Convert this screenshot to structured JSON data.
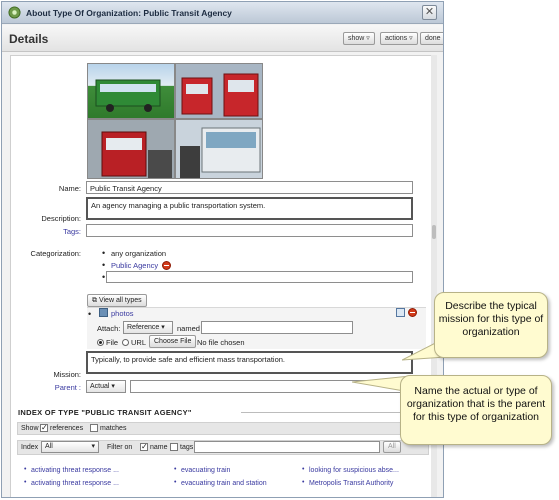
{
  "window": {
    "title": "About Type Of Organization: Public Transit Agency"
  },
  "header": {
    "title": "Details",
    "show_label": "show",
    "actions_label": "actions",
    "done_label": "done"
  },
  "form": {
    "name_label": "Name:",
    "name_value": "Public Transit Agency",
    "description_label": "Description:",
    "description_value": "An agency managing a public transportation system.",
    "tags_label": "Tags:",
    "categorization_label": "Categorization:",
    "categories": [
      "any organization",
      "Public Agency"
    ],
    "view_all_types_label": "View all types",
    "attachment_name": "photos",
    "attach_label": "Attach:",
    "attach_type": "Reference",
    "named_label": "named",
    "file_option": "File",
    "url_option": "URL",
    "choose_file_label": "Choose File",
    "no_file_label": "No file chosen",
    "mission_label": "Mission:",
    "mission_value": "Typically, to provide safe and efficient mass transportation.",
    "parent_label": "Parent :",
    "parent_kind": "Actual"
  },
  "index": {
    "title": "INDEX OF TYPE \"PUBLIC TRANSIT AGENCY\"",
    "show_label": "Show",
    "references_label": "references",
    "matches_label": "matches",
    "index_label": "Index",
    "index_select": "All",
    "filter_on_label": "Filter on",
    "name_label": "name",
    "tags_label": "tags",
    "all_button": "All",
    "columns": [
      [
        "activating threat response ...",
        "activating threat response ..."
      ],
      [
        "evacuating train",
        "evacuating train and station"
      ],
      [
        "looking for suspicious abse...",
        "Metropolis Transit Authority"
      ]
    ]
  },
  "callouts": {
    "mission": "Describe the typical mission for this type of organization",
    "parent": "Name the actual or type of organization that is the parent for this type of organization"
  },
  "colors": {
    "link": "#3a3aa0",
    "callout_bg": "#fffbd0",
    "titlebar": "#bcc8d6",
    "delete": "#d23a1a"
  },
  "icons": [
    "app-gear-icon",
    "close-icon",
    "chevron-down-icon",
    "attachment-icon",
    "copy-icon",
    "delete-icon",
    "view-all-icon"
  ]
}
